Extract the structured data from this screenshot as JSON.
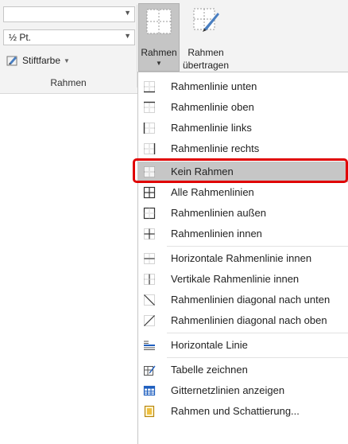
{
  "ribbon": {
    "width_combo_value": "",
    "weight_combo_value": "½ Pt.",
    "pen_color_label": "Stiftfarbe",
    "group_label": "Rahmen",
    "borders_button_label": "Rahmen",
    "painter_button_label_line1": "Rahmen",
    "painter_button_label_line2": "übertragen"
  },
  "menu": {
    "items": [
      {
        "label": "Rahmenlinie unten",
        "icon": "border-bottom-icon"
      },
      {
        "label": "Rahmenlinie oben",
        "icon": "border-top-icon"
      },
      {
        "label": "Rahmenlinie links",
        "icon": "border-left-icon"
      },
      {
        "label": "Rahmenlinie rechts",
        "icon": "border-right-icon"
      },
      {
        "label": "Kein Rahmen",
        "icon": "no-border-icon"
      },
      {
        "label": "Alle Rahmenlinien",
        "icon": "all-borders-icon"
      },
      {
        "label": "Rahmenlinien außen",
        "icon": "outside-borders-icon"
      },
      {
        "label": "Rahmenlinien innen",
        "icon": "inside-borders-icon"
      },
      {
        "label": "Horizontale Rahmenlinie innen",
        "icon": "inside-horizontal-border-icon"
      },
      {
        "label": "Vertikale Rahmenlinie innen",
        "icon": "inside-vertical-border-icon"
      },
      {
        "label": "Rahmenlinien diagonal nach unten",
        "icon": "diagonal-down-border-icon"
      },
      {
        "label": "Rahmenlinien diagonal nach oben",
        "icon": "diagonal-up-border-icon"
      },
      {
        "label": "Horizontale Linie",
        "icon": "horizontal-line-icon"
      },
      {
        "label": "Tabelle zeichnen",
        "icon": "draw-table-icon"
      },
      {
        "label": "Gitternetzlinien anzeigen",
        "icon": "view-gridlines-icon"
      },
      {
        "label": "Rahmen und Schattierung...",
        "icon": "borders-shading-icon"
      }
    ],
    "selected_label": "Kein Rahmen"
  },
  "colors": {
    "highlight": "#e00000",
    "selected_bg": "#c6c6c6",
    "ribbon_bg": "#f3f3f3"
  }
}
